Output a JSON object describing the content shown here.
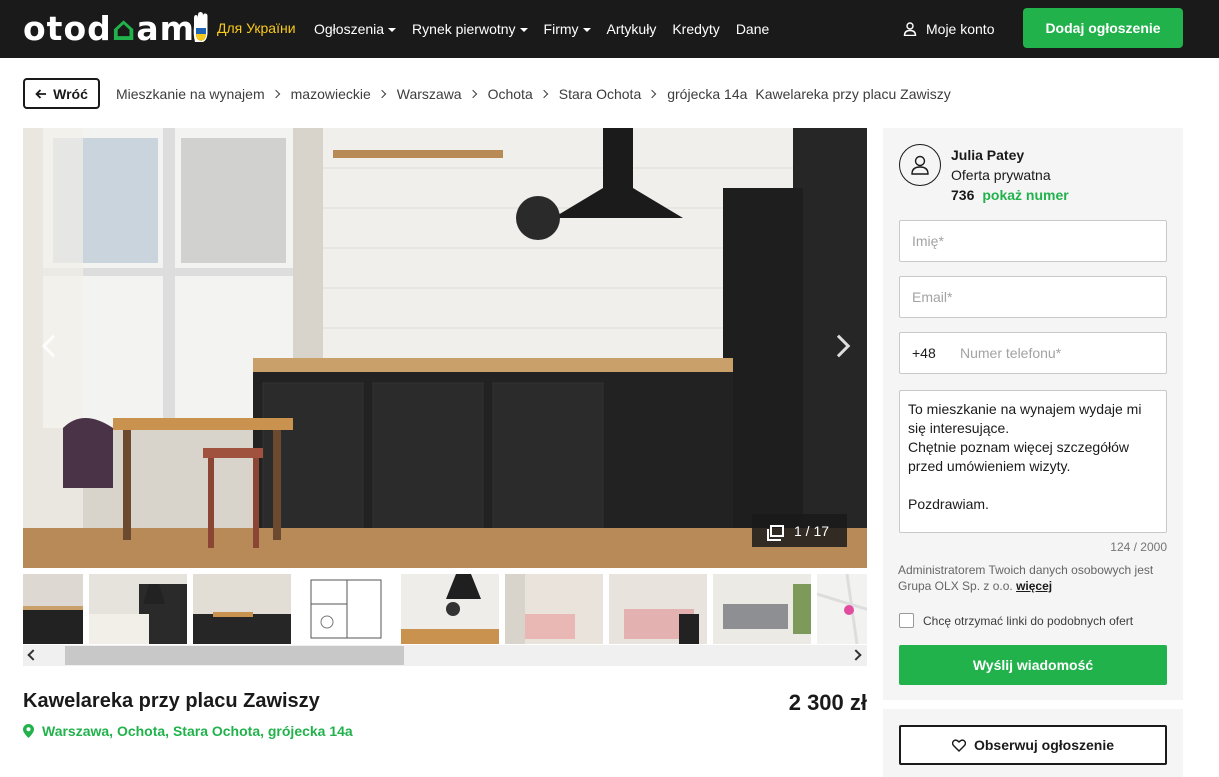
{
  "header": {
    "logo": {
      "part1": "otod",
      "part2": "am"
    },
    "ukraine_label": "Для України",
    "nav": [
      {
        "label": "Ogłoszenia",
        "dropdown": true
      },
      {
        "label": "Rynek pierwotny",
        "dropdown": true
      },
      {
        "label": "Firmy",
        "dropdown": true
      },
      {
        "label": "Artykuły",
        "dropdown": false
      },
      {
        "label": "Kredyty",
        "dropdown": false
      },
      {
        "label": "Dane",
        "dropdown": false
      }
    ],
    "account_label": "Moje konto",
    "add_listing_label": "Dodaj ogłoszenie"
  },
  "breadcrumb": {
    "back_label": "Wróć",
    "items": [
      "Mieszkanie na wynajem",
      "mazowieckie",
      "Warszawa",
      "Ochota",
      "Stara Ochota",
      "grójecka 14a"
    ],
    "current": "Kawelareka przy placu Zawiszy"
  },
  "gallery": {
    "counter": "1 / 17",
    "thumbnail_count": 9,
    "scroll_position": 0.05
  },
  "listing": {
    "title": "Kawelareka przy placu Zawiszy",
    "price": "2 300 zł",
    "location": "Warszawa, Ochota, Stara Ochota, grójecka 14a"
  },
  "contact": {
    "seller_name": "Julia Patey",
    "seller_type": "Oferta prywatna",
    "phone_partial": "736",
    "show_number": "pokaż numer",
    "name_placeholder": "Imię*",
    "email_placeholder": "Email*",
    "phone_prefix": "+48",
    "phone_placeholder": "Numer telefonu*",
    "message": "To mieszkanie na wynajem wydaje mi się interesujące.\nChętnie poznam więcej szczegółów przed umówieniem wizyty.\n\nPozdrawiam.",
    "char_count": "124 / 2000",
    "admin_note": "Administratorem Twoich danych osobowych jest Grupa OLX Sp. z o.o.",
    "admin_more": "więcej",
    "checkbox_label": "Chcę otrzymać linki do podobnych ofert",
    "send_label": "Wyślij wiadomość",
    "observe_label": "Obserwuj ogłoszenie"
  },
  "colors": {
    "brand_green": "#22b24c",
    "header_bg": "#1a1a1a",
    "ukraine_yellow": "#f8c91d",
    "ukraine_blue": "#1f64b5"
  }
}
